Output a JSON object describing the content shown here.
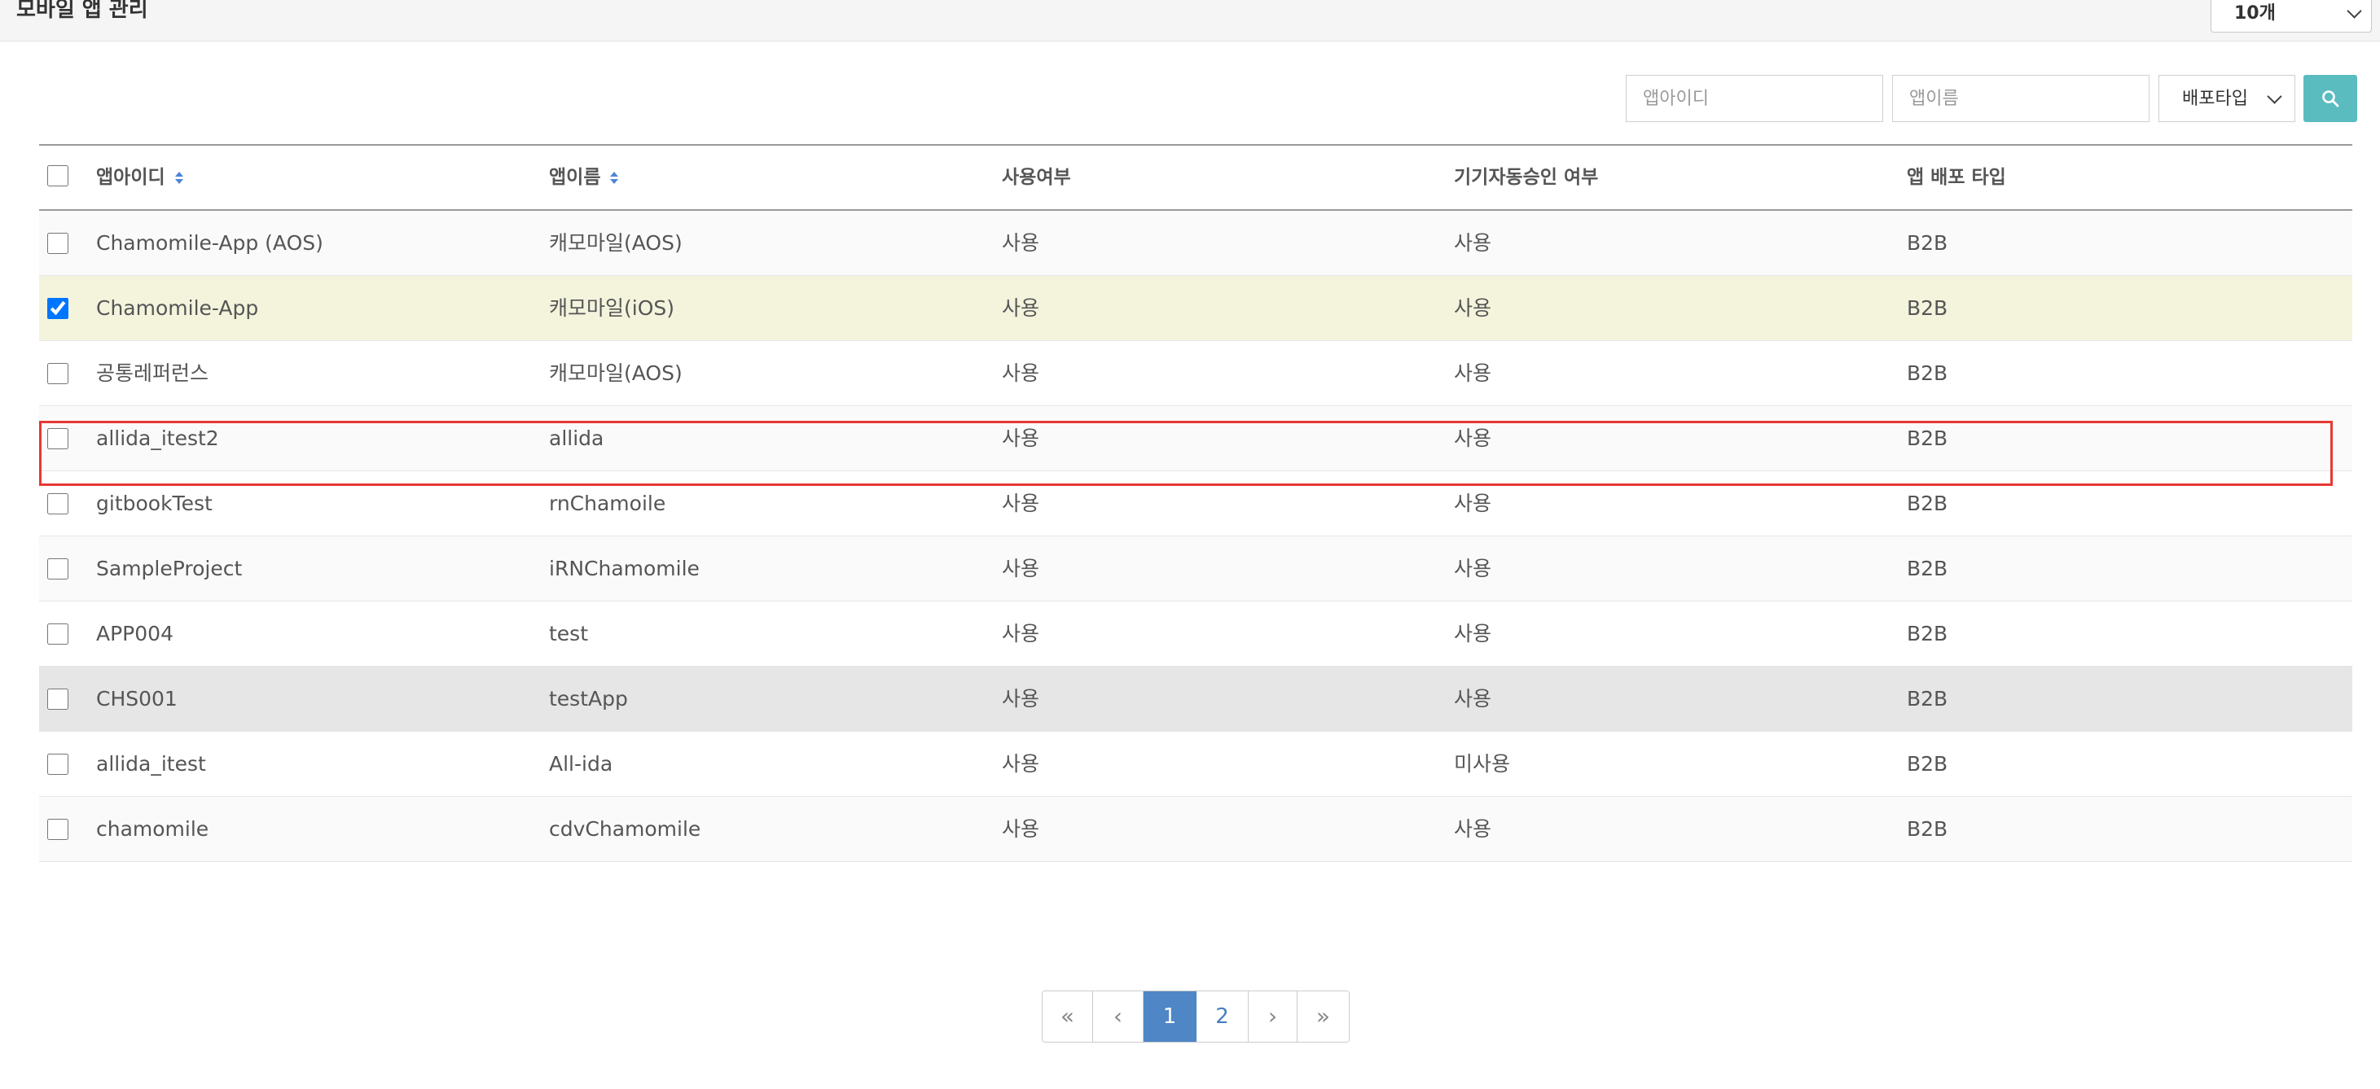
{
  "header": {
    "title": "모바일 앱 관리",
    "page_size": "10개"
  },
  "search": {
    "app_id_placeholder": "앱아이디",
    "app_name_placeholder": "앱이름",
    "deploy_type": "배포타입",
    "search_icon": "magnifier-icon"
  },
  "table": {
    "headers": {
      "app_id": "앱아이디",
      "app_name": "앱이름",
      "use_yn": "사용여부",
      "auto_approve": "기기자동승인 여부",
      "deploy_type": "앱 배포 타입"
    },
    "rows": [
      {
        "app_id": "Chamomile-App (AOS)",
        "app_name": "캐모마일(AOS)",
        "use_yn": "사용",
        "auto_approve": "사용",
        "deploy_type": "B2B",
        "checked": false
      },
      {
        "app_id": "Chamomile-App",
        "app_name": "캐모마일(iOS)",
        "use_yn": "사용",
        "auto_approve": "사용",
        "deploy_type": "B2B",
        "checked": true
      },
      {
        "app_id": "공통레퍼런스",
        "app_name": "캐모마일(AOS)",
        "use_yn": "사용",
        "auto_approve": "사용",
        "deploy_type": "B2B",
        "checked": false
      },
      {
        "app_id": "allida_itest2",
        "app_name": "allida",
        "use_yn": "사용",
        "auto_approve": "사용",
        "deploy_type": "B2B",
        "checked": false
      },
      {
        "app_id": "gitbookTest",
        "app_name": "rnChamoile",
        "use_yn": "사용",
        "auto_approve": "사용",
        "deploy_type": "B2B",
        "checked": false
      },
      {
        "app_id": "SampleProject",
        "app_name": "iRNChamomile",
        "use_yn": "사용",
        "auto_approve": "사용",
        "deploy_type": "B2B",
        "checked": false
      },
      {
        "app_id": "APP004",
        "app_name": "test",
        "use_yn": "사용",
        "auto_approve": "사용",
        "deploy_type": "B2B",
        "checked": false
      },
      {
        "app_id": "CHS001",
        "app_name": "testApp",
        "use_yn": "사용",
        "auto_approve": "사용",
        "deploy_type": "B2B",
        "checked": false
      },
      {
        "app_id": "allida_itest",
        "app_name": "All-ida",
        "use_yn": "사용",
        "auto_approve": "미사용",
        "deploy_type": "B2B",
        "checked": false
      },
      {
        "app_id": "chamomile",
        "app_name": "cdvChamomile",
        "use_yn": "사용",
        "auto_approve": "사용",
        "deploy_type": "B2B",
        "checked": false
      }
    ]
  },
  "pagination": {
    "first": "«",
    "prev": "‹",
    "pages": [
      "1",
      "2"
    ],
    "current": "1",
    "next": "›",
    "last": "»"
  },
  "colors": {
    "search_button": "#5bbcc0",
    "active_page": "#4f86c6",
    "selected_row": "#f4f4dd",
    "highlight_border": "#e53935"
  }
}
